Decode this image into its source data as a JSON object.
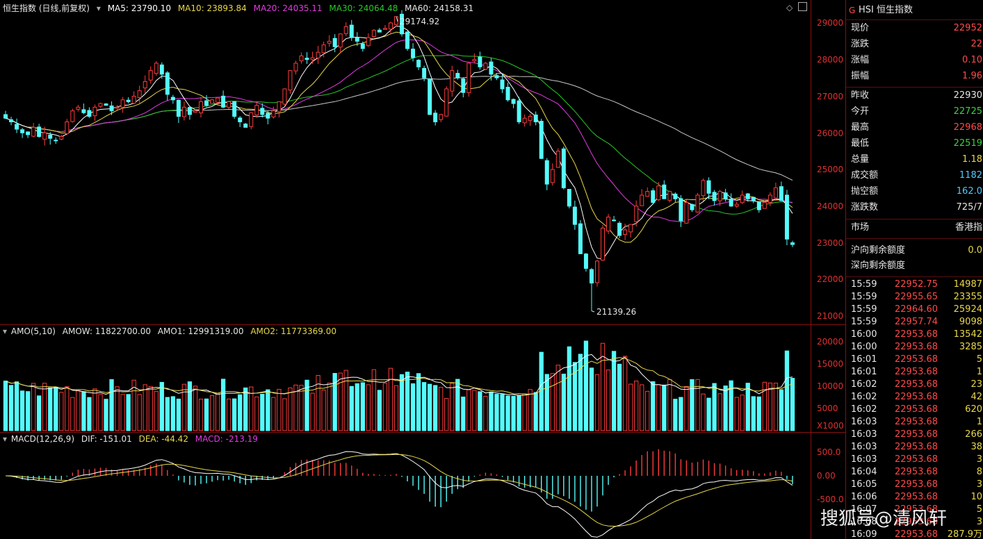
{
  "colors": {
    "up": "#ff3b3b",
    "down": "#54fcfc",
    "ma5": "#ffffff",
    "ma10": "#e8d84a",
    "ma20": "#e23be2",
    "ma30": "#28c828",
    "ma60": "#c8c8c8",
    "grid": "#8a1010",
    "axis": "#e03030"
  },
  "main_legend": {
    "title": "恒生指数 (日线,前复权)",
    "ma5": "MA5: 23790.10",
    "ma10": "MA10: 23893.84",
    "ma20": "MA20: 24035.11",
    "ma30": "MA30: 24064.48",
    "ma60": "MA60: 24158.31"
  },
  "annotations": {
    "high": "29174.92",
    "low": "21139.26"
  },
  "price_ticks": [
    "29000",
    "28000",
    "27000",
    "26000",
    "25000",
    "24000",
    "23000",
    "22000",
    "21000"
  ],
  "amo_legend": {
    "title": "AMO(5,10)",
    "amow": "AMOW: 11822700.00",
    "amo1": "AMO1: 12991319.00",
    "amo2": "AMO2: 11773369.00"
  },
  "amo_ticks": [
    "20000",
    "15000",
    "10000",
    "5000"
  ],
  "amo_unit": "X1000",
  "macd_legend": {
    "title": "MACD(12,26,9)",
    "dif": "DIF: -151.01",
    "dea": "DEA: -44.42",
    "macd": "MACD: -213.19"
  },
  "macd_ticks": [
    "500.0",
    "0.00",
    "-500.0"
  ],
  "side": {
    "header": "HSI 恒生指数",
    "header_icon": "G",
    "quote": [
      {
        "k": "现价",
        "v": "22952",
        "c": "#ff4a4a"
      },
      {
        "k": "涨跌",
        "v": "22",
        "c": "#ff4a4a"
      },
      {
        "k": "涨幅",
        "v": "0.10",
        "c": "#ff4a4a"
      },
      {
        "k": "振幅",
        "v": "1.96",
        "c": "#ff4a4a"
      }
    ],
    "quote2": [
      {
        "k": "昨收",
        "v": "22930",
        "c": "#e6e6e6"
      },
      {
        "k": "今开",
        "v": "22725",
        "c": "#3cd23c"
      },
      {
        "k": "最高",
        "v": "22968",
        "c": "#ff4a4a"
      },
      {
        "k": "最低",
        "v": "22519",
        "c": "#3cd23c"
      },
      {
        "k": "总量",
        "v": "1.18",
        "c": "#e8d84a"
      },
      {
        "k": "成交额",
        "v": "1182",
        "c": "#54c8fc"
      },
      {
        "k": "抛空额",
        "v": "162.0",
        "c": "#54c8fc"
      },
      {
        "k": "涨跌数",
        "v": "725/7",
        "c": "#e6e6e6"
      }
    ],
    "market": {
      "k": "市场",
      "v": "香港指"
    },
    "quota": [
      {
        "k": "沪向剩余额度",
        "v": "0.0",
        "c": "#e8d84a"
      },
      {
        "k": "深向剩余额度",
        "v": "",
        "c": "#e8d84a"
      }
    ],
    "ticks": [
      {
        "t": "15:59",
        "p": "22952.75",
        "q": "14987",
        "c": "#e8d84a"
      },
      {
        "t": "15:59",
        "p": "22955.65",
        "q": "23355",
        "c": "#e8d84a"
      },
      {
        "t": "15:59",
        "p": "22964.60",
        "q": "25924",
        "c": "#e8d84a"
      },
      {
        "t": "15:59",
        "p": "22957.74",
        "q": "9098",
        "c": "#e8d84a"
      },
      {
        "t": "16:00",
        "p": "22953.68",
        "q": "13542",
        "c": "#e8d84a"
      },
      {
        "t": "16:00",
        "p": "22953.68",
        "q": "3285",
        "c": "#e8d84a"
      },
      {
        "t": "16:01",
        "p": "22953.68",
        "q": "5",
        "c": "#e8d84a"
      },
      {
        "t": "16:01",
        "p": "22953.68",
        "q": "1",
        "c": "#e8d84a"
      },
      {
        "t": "16:02",
        "p": "22953.68",
        "q": "23",
        "c": "#e8d84a"
      },
      {
        "t": "16:02",
        "p": "22953.68",
        "q": "42",
        "c": "#e8d84a"
      },
      {
        "t": "16:02",
        "p": "22953.68",
        "q": "620",
        "c": "#e8d84a"
      },
      {
        "t": "16:03",
        "p": "22953.68",
        "q": "1",
        "c": "#e8d84a"
      },
      {
        "t": "16:03",
        "p": "22953.68",
        "q": "266",
        "c": "#e8d84a"
      },
      {
        "t": "16:03",
        "p": "22953.68",
        "q": "38",
        "c": "#e8d84a"
      },
      {
        "t": "16:03",
        "p": "22953.68",
        "q": "3",
        "c": "#e8d84a"
      },
      {
        "t": "16:04",
        "p": "22953.68",
        "q": "8",
        "c": "#e8d84a"
      },
      {
        "t": "16:05",
        "p": "22953.68",
        "q": "3",
        "c": "#e8d84a"
      },
      {
        "t": "16:06",
        "p": "22953.68",
        "q": "10",
        "c": "#e8d84a"
      },
      {
        "t": "16:07",
        "p": "22953.68",
        "q": "5",
        "c": "#e8d84a"
      },
      {
        "t": "16:08",
        "p": "22953.68",
        "q": "3",
        "c": "#e8d84a"
      },
      {
        "t": "16:09",
        "p": "22953.68",
        "q": "287.9万",
        "c": "#e8d84a"
      }
    ]
  },
  "watermark": "搜狐号@清风轩",
  "chart_data": [
    {
      "type": "candlestick",
      "title": "恒生指数 (日线,前复权)",
      "series_close": [
        26400,
        26300,
        26100,
        26000,
        25950,
        26150,
        25900,
        26000,
        25850,
        25800,
        25900,
        26300,
        26600,
        26700,
        26550,
        26450,
        26700,
        26800,
        26750,
        26600,
        26700,
        26900,
        26850,
        27000,
        27150,
        27400,
        27700,
        27900,
        27600,
        27050,
        26900,
        26450,
        26700,
        26500,
        26600,
        26850,
        26750,
        26900,
        26950,
        26700,
        26850,
        26450,
        26300,
        26150,
        26550,
        26750,
        26500,
        26400,
        26600,
        26850,
        27200,
        27700,
        27900,
        28100,
        28000,
        28050,
        28200,
        28400,
        28500,
        28350,
        28700,
        28900,
        28600,
        28500,
        28300,
        28600,
        28800,
        28750,
        28850,
        29000,
        29174,
        28700,
        28300,
        28050,
        27800,
        27500,
        26500,
        26300,
        26500,
        27200,
        27700,
        27500,
        27100,
        27900,
        28000,
        27800,
        27900,
        27600,
        27500,
        27200,
        26900,
        26800,
        26300,
        26400,
        26450,
        26300,
        25300,
        24600,
        25000,
        25500,
        24500,
        24000,
        23500,
        22700,
        22300,
        21900,
        22500,
        23400,
        23700,
        23600,
        23200,
        23350,
        23500,
        24000,
        24300,
        24400,
        24100,
        24550,
        24200,
        24400,
        24200,
        23600,
        24100,
        23900,
        24300,
        24700,
        24350,
        24150,
        24400,
        24200,
        24000,
        24050,
        24300,
        24200,
        24150,
        23900,
        24100,
        24300,
        24500,
        24150,
        23100,
        22952
      ],
      "ma_last": {
        "MA5": 23790.1,
        "MA10": 23893.84,
        "MA20": 24035.11,
        "MA30": 24064.48,
        "MA60": 24158.31
      },
      "high_label": 29174.92,
      "low_label": 21139.26,
      "ylim": [
        20800,
        29300
      ]
    },
    {
      "type": "bar",
      "title": "AMO(5,10)",
      "unit": "X1000",
      "ylim": [
        0,
        20500
      ]
    },
    {
      "type": "bar",
      "title": "MACD(12,26,9)",
      "ylim": [
        -700,
        700
      ]
    }
  ]
}
